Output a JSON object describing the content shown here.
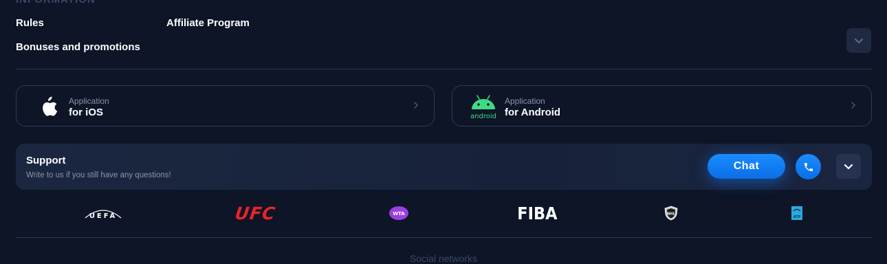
{
  "information": {
    "heading": "Information",
    "links": [
      "Rules",
      "Affiliate Program",
      "Bonuses and promotions"
    ]
  },
  "apps": [
    {
      "sub": "Application",
      "title": "for iOS",
      "icon": "apple-icon"
    },
    {
      "sub": "Application",
      "title": "for Android",
      "icon": "android-icon",
      "icon_caption": "android"
    }
  ],
  "support": {
    "title": "Support",
    "subtitle": "Write to us if you still have any questions!",
    "chat_label": "Chat",
    "phone_icon": "phone-icon",
    "expand_icon": "chevron-down-icon"
  },
  "partners": {
    "uefa": "UEFA",
    "ufc": "UFC",
    "wta": "WTA",
    "fiba": "FIBA",
    "nhl": "NHL",
    "atp": "ATP"
  },
  "social": {
    "heading": "Social networks"
  },
  "colors": {
    "background": "#0d1527",
    "accent": "#1a8cff",
    "android_green": "#3ddc84",
    "ufc_red": "#e8242a",
    "wta_purple": "#9b3fe0",
    "atp_blue": "#2aa9e0"
  }
}
